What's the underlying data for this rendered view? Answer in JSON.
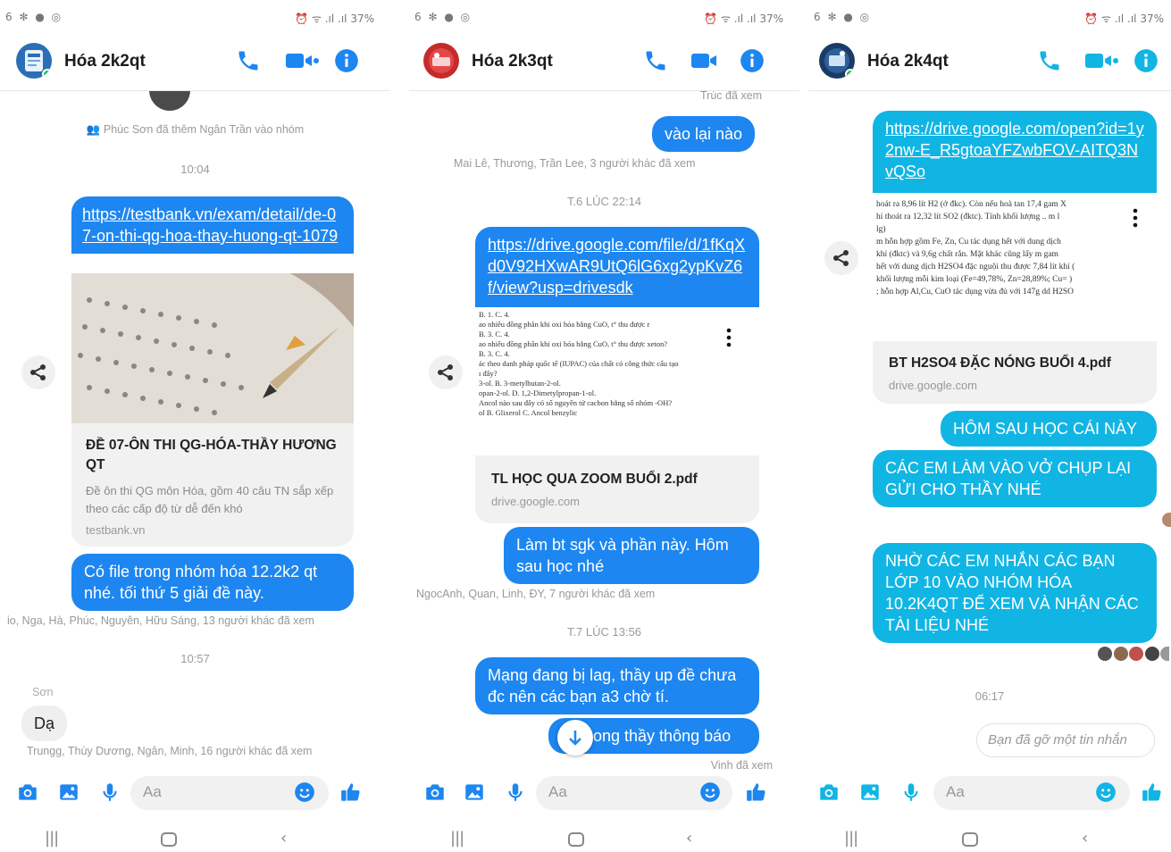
{
  "statusbar": {
    "left_icons": "6 ✻ ● ◎",
    "right_text": "⏰ ᯤ .ıl .ıl 37%",
    "battery": "37%"
  },
  "colors": {
    "messenger_blue": "#1d86f0",
    "cyan": "#11b5e4",
    "online": "#31c24d"
  },
  "phones": [
    {
      "title": "Hóa 2k2qt",
      "system_note": "Phúc Sơn đã thêm Ngân Trần vào nhóm",
      "time1": "10:04",
      "link_message": "https://testbank.vn/exam/detail/de-07-on-thi-qg-hoa-thay-huong-qt-1079",
      "card": {
        "title": "ĐỀ 07-ÔN THI QG-HÓA-THẦY HƯƠNG QT",
        "desc": "Đề ôn thi QG môn Hóa, gồm 40 câu TN sắp xếp theo các cấp độ từ dễ đến khó",
        "domain": "testbank.vn"
      },
      "message2": "Có file trong nhóm hóa 12.2k2 qt nhé. tối thứ 5 giải đề này.",
      "seen1": "io, Nga, Hà, Phúc, Nguyên, Hữu Sáng, 13 người khác đã xem",
      "time2": "10:57",
      "sender": "Sơn",
      "reply": "Dạ",
      "seen2": "Trungg, Thùy Dương, Ngân, Minh, 16 người khác đã xem",
      "composer_placeholder": "Aa"
    },
    {
      "title": "Hóa 2k3qt",
      "seen_top": "Trúc đã xem",
      "message1": "vào lại nào",
      "seen1": "Mai Lê, Thương, Trần Lee, 3 người khác đã xem",
      "time1": "T.6 LÚC 22:14",
      "link_message": "https://drive.google.com/file/d/1fKqXd0V92HXwAR9UtQ6lG6xg2ypKvZ6f/view?usp=drivesdk",
      "card": {
        "title": "TL HỌC QUA ZOOM BUỔI 2.pdf",
        "domain": "drive.google.com"
      },
      "doc_lines": [
        "B. 1.                                          C. 4.",
        "ao nhiêu đồng phân khi oxi hóa bằng CuO, t° thu được r",
        "B. 3.                                          C. 4.",
        "ao nhiêu đồng phân khi oxi hóa bằng CuO, t° thu được xeton?",
        "B. 3.                                          C. 4.",
        "ác theo danh pháp quốc tế (IUPAC) của chất có công thức cấu tạo",
        "ı đây?",
        "3-ol.                                   B. 3-metylbutan-2-ol.",
        "opan-2-ol.                            D. 1,2-Dimetylpropan-1-ol.",
        "Ancol nào sau đây có số nguyên tử cacbon bằng số nhóm -OH?",
        "ol          B. Glixerol                C. Ancol benzylic"
      ],
      "message2": "Làm bt sgk và phần này. Hôm sau học nhé",
      "seen2": "NgocAnh, Quan, Linh, ĐY, 7 người khác đã xem",
      "time2": "T.7 LÚC 13:56",
      "message3": "Mạng đang bị lag, thầy up đề chưa đc nên các bạn a3 chờ tí.",
      "message4": "Trong thầy thông báo",
      "message4_visible": "ong thầy thông báo",
      "seen3": "Vinh đã xem",
      "composer_placeholder": "Aa"
    },
    {
      "title": "Hóa 2k4qt",
      "link_message": "https://drive.google.com/open?id=1y2nw-E_R5gtoaYFZwbFOV-AITQ3NvQSo",
      "doc_lines": [
        "hoát ra 8,96 lít H2 (ở đkc). Còn nếu hoà tan 17,4 gam X",
        "hí thoát ra 12,32 lít SO2 (đktc). Tính khối lượng ..          m l",
        "lg)",
        "m hỗn hợp gồm Fe, Zn, Cu tác dụng hết với dung dịch",
        " khí (đktc) và 9,6g chất rắn. Mặt khác cũng lấy m gam",
        "hết với dung dịch H2SO4 đặc nguội thu được 7,84 lít khí (",
        "khối lượng mỗi kim loại (Fe=49,78%, Zn=28,89%; Cu= )",
        "; hỗn hợp Al,Cu, CuO tác dụng vừa đủ với 147g dd H2SO"
      ],
      "card": {
        "title": "BT H2SO4 ĐẶC NÓNG BUỔI 4.pdf",
        "domain": "drive.google.com"
      },
      "message2": "HÔM SAU HỌC CÁI NÀY",
      "message3": "CÁC EM LÀM VÀO VỞ CHỤP LẠI GỬI CHO THẦY NHÉ",
      "message4": "NHỜ CÁC EM NHẮN CÁC BẠN LỚP 10 VÀO NHÓM HÓA 10.2K4QT ĐỂ XEM VÀ NHẬN CÁC TÀI LIỆU NHÉ",
      "time1": "06:17",
      "removed": "Bạn đã gỡ một tin nhắn",
      "composer_placeholder": "Aa"
    }
  ],
  "icons": [
    "phone-icon",
    "video-call-icon",
    "info-icon",
    "share-icon",
    "camera-icon",
    "gallery-icon",
    "microphone-icon",
    "emoji-icon",
    "like-thumb-icon",
    "recents-nav-icon",
    "home-nav-icon",
    "back-nav-icon",
    "scroll-down-icon",
    "more-vert-icon"
  ]
}
